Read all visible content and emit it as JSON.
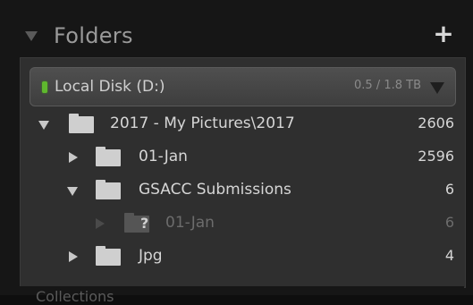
{
  "panel": {
    "title": "Folders",
    "add_label": "+"
  },
  "disk": {
    "label": "Local Disk (D:)",
    "usage": "0.5 / 1.8 TB",
    "status_color": "#5fb82e"
  },
  "tree": [
    {
      "label": "2017 - My Pictures\\2017",
      "count": "2606",
      "expanded": true,
      "depth": 0
    },
    {
      "label": "01-Jan",
      "count": "2596",
      "expanded": false,
      "depth": 1
    },
    {
      "label": "GSACC Submissions",
      "count": "6",
      "expanded": true,
      "depth": 1
    },
    {
      "label": "01-Jan",
      "count": "6",
      "expanded": false,
      "depth": 2,
      "missing": true
    },
    {
      "label": "Jpg",
      "count": "4",
      "expanded": false,
      "depth": 1
    }
  ],
  "next_panel_peek": "Collections"
}
